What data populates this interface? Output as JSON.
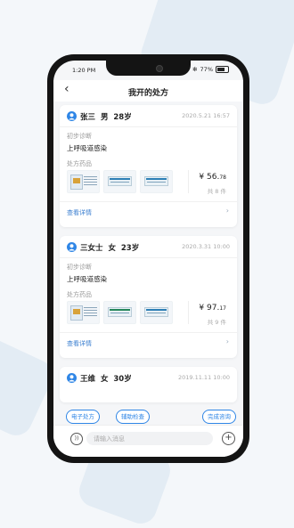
{
  "status_bar": {
    "time": "1:20 PM",
    "battery": "77%"
  },
  "header": {
    "title": "我开的处方",
    "back_icon": "‹"
  },
  "prescriptions": [
    {
      "name": "张三",
      "gender": "男",
      "age": "28岁",
      "date": "2020.5.21 16:57",
      "diagnosis_label": "初步诊断",
      "diagnosis": "上呼吸道感染",
      "drugs_label": "处方药品",
      "price_symbol": "¥",
      "price_int": "56.",
      "price_dec": "78",
      "count": "共 8 件",
      "detail_label": "查看详情"
    },
    {
      "name": "三女士",
      "gender": "女",
      "age": "23岁",
      "date": "2020.3.31 10:00",
      "diagnosis_label": "初步诊断",
      "diagnosis": "上呼吸道感染",
      "drugs_label": "处方药品",
      "price_symbol": "¥",
      "price_int": "97.",
      "price_dec": "17",
      "count": "共 9 件",
      "detail_label": "查看详情"
    },
    {
      "name": "王维",
      "gender": "女",
      "age": "30岁",
      "date": "2019.11.11 10:00"
    }
  ],
  "chips": [
    "电子处方",
    "辅助检查",
    "完成咨询"
  ],
  "input": {
    "placeholder": "请输入消息"
  }
}
